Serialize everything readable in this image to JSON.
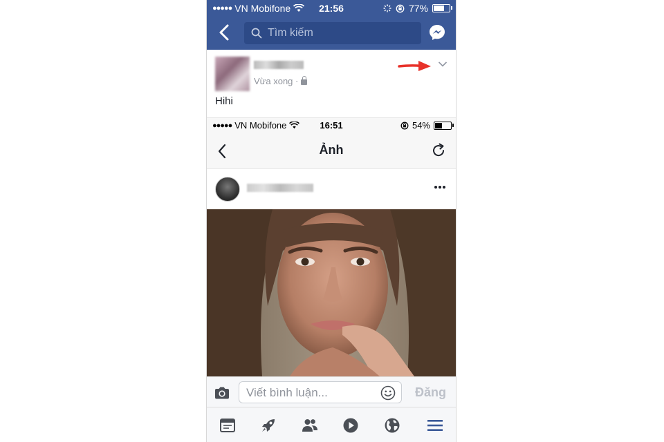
{
  "status_bar": {
    "carrier": "VN Mobifone",
    "time": "21:56",
    "battery": "77%",
    "battery_level": 0.77
  },
  "header": {
    "search_placeholder": "Tìm kiếm"
  },
  "post": {
    "meta": "Vừa xong ·",
    "text": "Hihi"
  },
  "embedded": {
    "status_bar": {
      "carrier": "VN Mobifone",
      "time": "16:51",
      "battery": "54%",
      "battery_level": 0.54
    },
    "nav_title": "Ảnh",
    "comment_placeholder": "Viết bình luận...",
    "post_button": "Đăng",
    "tabs": [
      "news-feed-icon",
      "rocket-icon",
      "friends-icon",
      "video-icon",
      "globe-icon",
      "menu-icon"
    ]
  },
  "colors": {
    "facebook_blue": "#3b5998",
    "arrow_red": "#e8322a",
    "tab_active": "#3b5998",
    "tab_inactive": "#4b4f56"
  }
}
